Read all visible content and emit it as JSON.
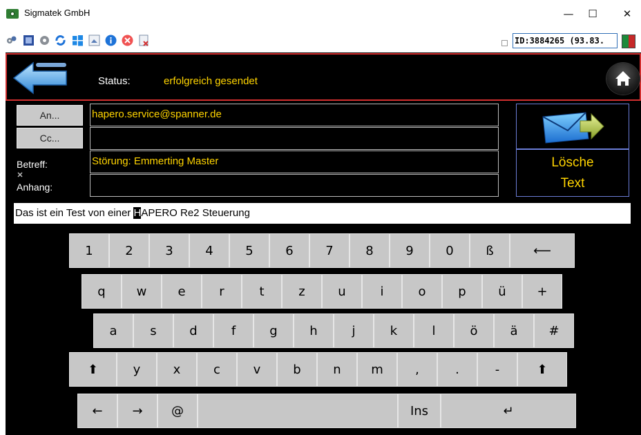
{
  "window": {
    "title": "Sigmatek GmbH",
    "controls": [
      "—",
      "☐",
      "✕"
    ]
  },
  "toolbar": {
    "icons": [
      "network-settings-icon",
      "fullscreen-icon",
      "settings-gear-icon",
      "refresh-icon",
      "windows-icon",
      "screenshot-icon",
      "info-icon",
      "close-red-icon",
      "disconnect-icon"
    ],
    "id_text": "ID:3884265 (93.83.",
    "flag_colors": [
      "#1d8a3a",
      "#c62828"
    ]
  },
  "status": {
    "label": "Status:",
    "value": "erfolgreich gesendet"
  },
  "email": {
    "to_button": "An...",
    "cc_button": "Cc...",
    "subject_label": "Betreff:",
    "attachment_label": "Anhang:",
    "to_value": "hapero.service@spanner.de",
    "cc_value": "",
    "subject_value": "Störung: Emmerting Master",
    "attachment_value": "",
    "clear_line1": "Lösche",
    "clear_line2": "Text"
  },
  "message": {
    "before_cursor": "Das ist ein Test von einer ",
    "cursor_char": "H",
    "after_cursor": "APERO Re2 Steuerung"
  },
  "keyboard": {
    "rows": [
      [
        "1",
        "2",
        "3",
        "4",
        "5",
        "6",
        "7",
        "8",
        "9",
        "0",
        "ß",
        "⟵"
      ],
      [
        "q",
        "w",
        "e",
        "r",
        "t",
        "z",
        "u",
        "i",
        "o",
        "p",
        "ü",
        "+"
      ],
      [
        "a",
        "s",
        "d",
        "f",
        "g",
        "h",
        "j",
        "k",
        "l",
        "ö",
        "ä",
        "#"
      ],
      [
        "⬆",
        "y",
        "x",
        "c",
        "v",
        "b",
        "n",
        "m",
        ",",
        ".",
        "-",
        "⬆"
      ],
      [
        "←",
        "→",
        "@",
        "",
        "Ins",
        "↵"
      ]
    ]
  },
  "colors": {
    "accent_text": "#ffd400",
    "status_border": "#d32f2f",
    "panel_border": "#6c7ed8"
  }
}
